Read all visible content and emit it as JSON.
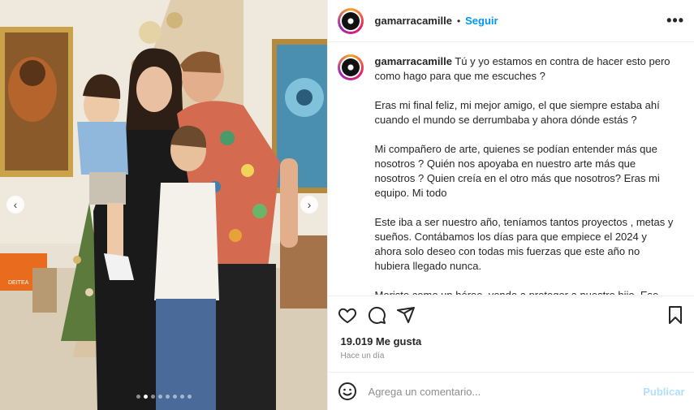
{
  "post": {
    "username": "gamarracamille",
    "separator": "•",
    "follow_label": "Seguir",
    "more_label": "•••",
    "caption_user": "gamarracamille",
    "caption_paragraphs": [
      "Tú y yo estamos en contra de hacer esto pero como hago para que me escuches ?",
      "Eras mi final feliz, mi mejor amigo, el que siempre estaba ahí cuando el mundo se derrumbaba y ahora dónde estás ?",
      "Mi compañero de arte, quienes se podían entender más que nosotros ? Quién nos apoyaba en nuestro arte más que nosotros ? Quien creía en el otro más que nosotros? Eras mi equipo. Mi todo",
      "Este iba a ser nuestro año, teníamos tantos proyectos , metas y sueños. Contábamos los días para que empiece el 2024 y ahora solo deseo con todas mis fuerzas que este año no hubiera llegado nunca.",
      "Moriste como un héroe, yendo a proteger a nuestro hijo. Ese amor tan grande sin medidas es lo que nos queda de consuelo."
    ],
    "likes": "19.019 Me gusta",
    "time": "Hace un día",
    "comment_placeholder": "Agrega un comentario...",
    "publish_label": "Publicar",
    "carousel": {
      "total": 8,
      "active": 1,
      "prev_label": "‹",
      "next_label": "›"
    },
    "photo_sign_text": "DEITEA",
    "colors": {
      "accent": "#0095f6",
      "publish_disabled": "#b2dffc",
      "muted": "#8e8e8e"
    }
  }
}
